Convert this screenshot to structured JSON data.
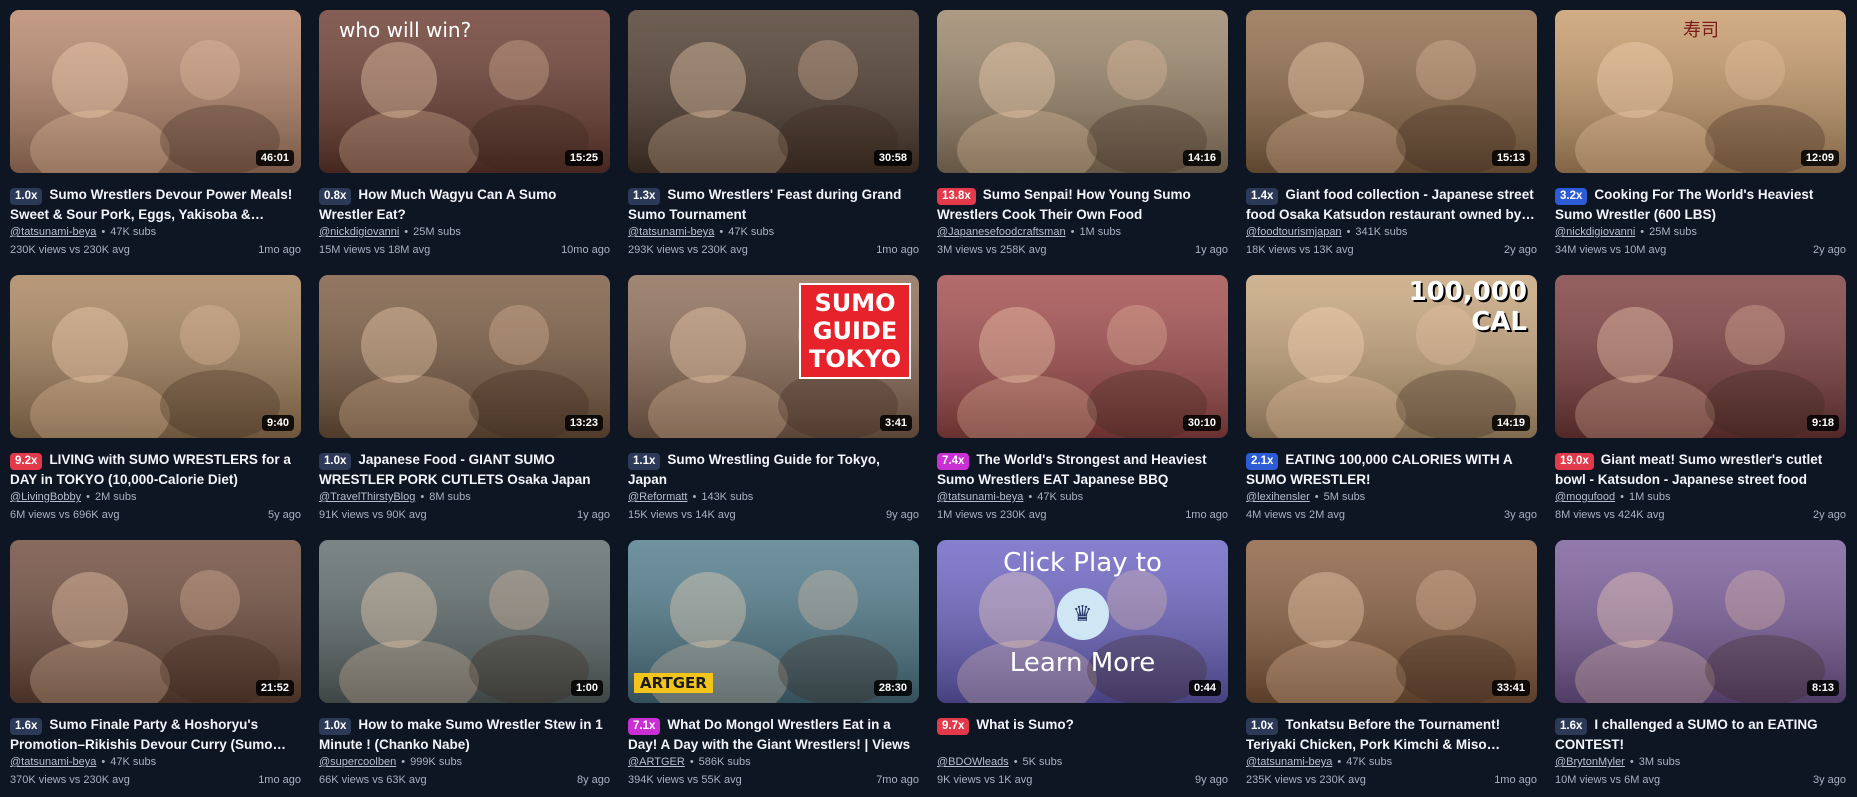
{
  "videos": [
    {
      "mult": "1.0x",
      "badge": "gray",
      "title": "Sumo Wrestlers Devour Power Meals! Sweet & Sour Pork, Eggs, Yakisoba & Oysters in One Feast",
      "channel": "@tatsunami-beya",
      "subs": "47K subs",
      "views": "230K views vs 230K avg",
      "age": "1mo ago",
      "duration": "46:01",
      "bg": "#b6856a"
    },
    {
      "mult": "0.8x",
      "badge": "gray",
      "title": "How Much Wagyu Can A Sumo Wrestler Eat?",
      "channel": "@nickdigiovanni",
      "subs": "25M subs",
      "views": "15M views vs 18M avg",
      "age": "10mo ago",
      "duration": "15:25",
      "bg": "#6a3b2f",
      "overlay": "who will win?"
    },
    {
      "mult": "1.3x",
      "badge": "gray",
      "title": "Sumo Wrestlers' Feast during Grand Sumo Tournament",
      "channel": "@tatsunami-beya",
      "subs": "47K subs",
      "views": "293K views vs 230K avg",
      "age": "1mo ago",
      "duration": "30:58",
      "bg": "#4d3a2c"
    },
    {
      "mult": "13.8x",
      "badge": "red",
      "title": "Sumo Senpai! How Young Sumo Wrestlers Cook Their Own Food",
      "channel": "@Japanesefoodcraftsman",
      "subs": "1M subs",
      "views": "3M views vs 258K avg",
      "age": "1y ago",
      "duration": "14:16",
      "bg": "#9a8468"
    },
    {
      "mult": "1.4x",
      "badge": "gray",
      "title": "Giant food collection - Japanese street food Osaka Katsudon restaurant owned by a former sumo wrestler",
      "channel": "@foodtourismjapan",
      "subs": "341K subs",
      "views": "18K views vs 13K avg",
      "age": "2y ago",
      "duration": "15:13",
      "bg": "#8f6a47"
    },
    {
      "mult": "3.2x",
      "badge": "blue",
      "title": "Cooking For The World's Heaviest Sumo Wrestler (600 LBS)",
      "channel": "@nickdigiovanni",
      "subs": "25M subs",
      "views": "34M views vs 10M avg",
      "age": "2y ago",
      "duration": "12:09",
      "bg": "#c79a6a",
      "overlay": "寿司"
    },
    {
      "mult": "9.2x",
      "badge": "red",
      "title": "LIVING with SUMO WRESTLERS for a DAY in TOKYO (10,000-Calorie Diet)",
      "channel": "@LivingBobby",
      "subs": "2M subs",
      "views": "6M views vs 696K avg",
      "age": "5y ago",
      "duration": "9:40",
      "bg": "#a7835c"
    },
    {
      "mult": "1.0x",
      "badge": "gray",
      "title": "Japanese Food - GIANT SUMO WRESTLER PORK CUTLETS Osaka Japan",
      "channel": "@TravelThirstyBlog",
      "subs": "8M subs",
      "views": "91K views vs 90K avg",
      "age": "1y ago",
      "duration": "13:23",
      "bg": "#7a5a40"
    },
    {
      "mult": "1.1x",
      "badge": "gray",
      "title": "Sumo Wrestling Guide for Tokyo, Japan",
      "channel": "@Reformatt",
      "subs": "143K subs",
      "views": "15K views vs 14K avg",
      "age": "9y ago",
      "duration": "3:41",
      "bg": "#8c6b55",
      "overlay": "SUMO GUIDE TOKYO"
    },
    {
      "mult": "7.4x",
      "badge": "pink",
      "title": "The World's Strongest and Heaviest Sumo Wrestlers EAT Japanese BBQ",
      "channel": "@tatsunami-beya",
      "subs": "47K subs",
      "views": "1M views vs 230K avg",
      "age": "1mo ago",
      "duration": "30:10",
      "bg": "#a24a4a"
    },
    {
      "mult": "2.1x",
      "badge": "blue",
      "title": "EATING 100,000 CALORIES WITH A SUMO WRESTLER!",
      "channel": "@lexihensler",
      "subs": "5M subs",
      "views": "4M views vs 2M avg",
      "age": "3y ago",
      "duration": "14:19",
      "bg": "#c6a47a",
      "overlay": "100,000 CAL"
    },
    {
      "mult": "19.0x",
      "badge": "red",
      "title": "Giant meat! Sumo wrestler's cutlet bowl - Katsudon - Japanese street food",
      "channel": "@mogufood",
      "subs": "1M subs",
      "views": "8M views vs 424K avg",
      "age": "2y ago",
      "duration": "9:18",
      "bg": "#7c3c3c"
    },
    {
      "mult": "1.6x",
      "badge": "gray",
      "title": "Sumo Finale Party & Hoshoryu's Promotion–Rikishis Devour Curry (Sumo Foods)",
      "channel": "@tatsunami-beya",
      "subs": "47K subs",
      "views": "370K views vs 230K avg",
      "age": "1mo ago",
      "duration": "21:52",
      "bg": "#6e4a3a"
    },
    {
      "mult": "1.0x",
      "badge": "gray",
      "title": "How to make Sumo Wrestler Stew in 1 Minute ! (Chanko Nabe)",
      "channel": "@supercoolben",
      "subs": "999K subs",
      "views": "66K views vs 63K avg",
      "age": "8y ago",
      "duration": "1:00",
      "bg": "#5e6a6a"
    },
    {
      "mult": "7.1x",
      "badge": "pink",
      "title": "What Do Mongol Wrestlers Eat in a Day! A Day with the Giant Wrestlers! | Views",
      "channel": "@ARTGER",
      "subs": "586K subs",
      "views": "394K views vs 55K avg",
      "age": "7mo ago",
      "duration": "28:30",
      "bg": "#4f7a8a",
      "overlay": "ARTGER"
    },
    {
      "mult": "9.7x",
      "badge": "red",
      "title": "What is Sumo?",
      "channel": "@BDOWleads",
      "subs": "5K subs",
      "views": "9K views vs 1K avg",
      "age": "9y ago",
      "duration": "0:44",
      "bg": "#6b63c4",
      "overlay": "Click Play to|Learn More"
    },
    {
      "mult": "1.0x",
      "badge": "gray",
      "title": "Tonkatsu Before the Tournament! Teriyaki Chicken, Pork Kimchi & Miso Chanko for Sumo Wrestlers",
      "channel": "@tatsunami-beya",
      "subs": "47K subs",
      "views": "235K views vs 230K avg",
      "age": "1mo ago",
      "duration": "33:41",
      "bg": "#8a5e3e"
    },
    {
      "mult": "1.6x",
      "badge": "gray",
      "title": "I challenged a SUMO to an EATING CONTEST!",
      "channel": "@BrytonMyler",
      "subs": "3M subs",
      "views": "10M views vs 6M avg",
      "age": "3y ago",
      "duration": "8:13",
      "bg": "#7a5c9a"
    }
  ],
  "colors": {
    "background": "#0e1523",
    "badge_gray": "#2c3a58",
    "badge_blue": "#2c5bd6",
    "badge_red": "#e23a4a",
    "badge_pink": "#c92fd3"
  }
}
